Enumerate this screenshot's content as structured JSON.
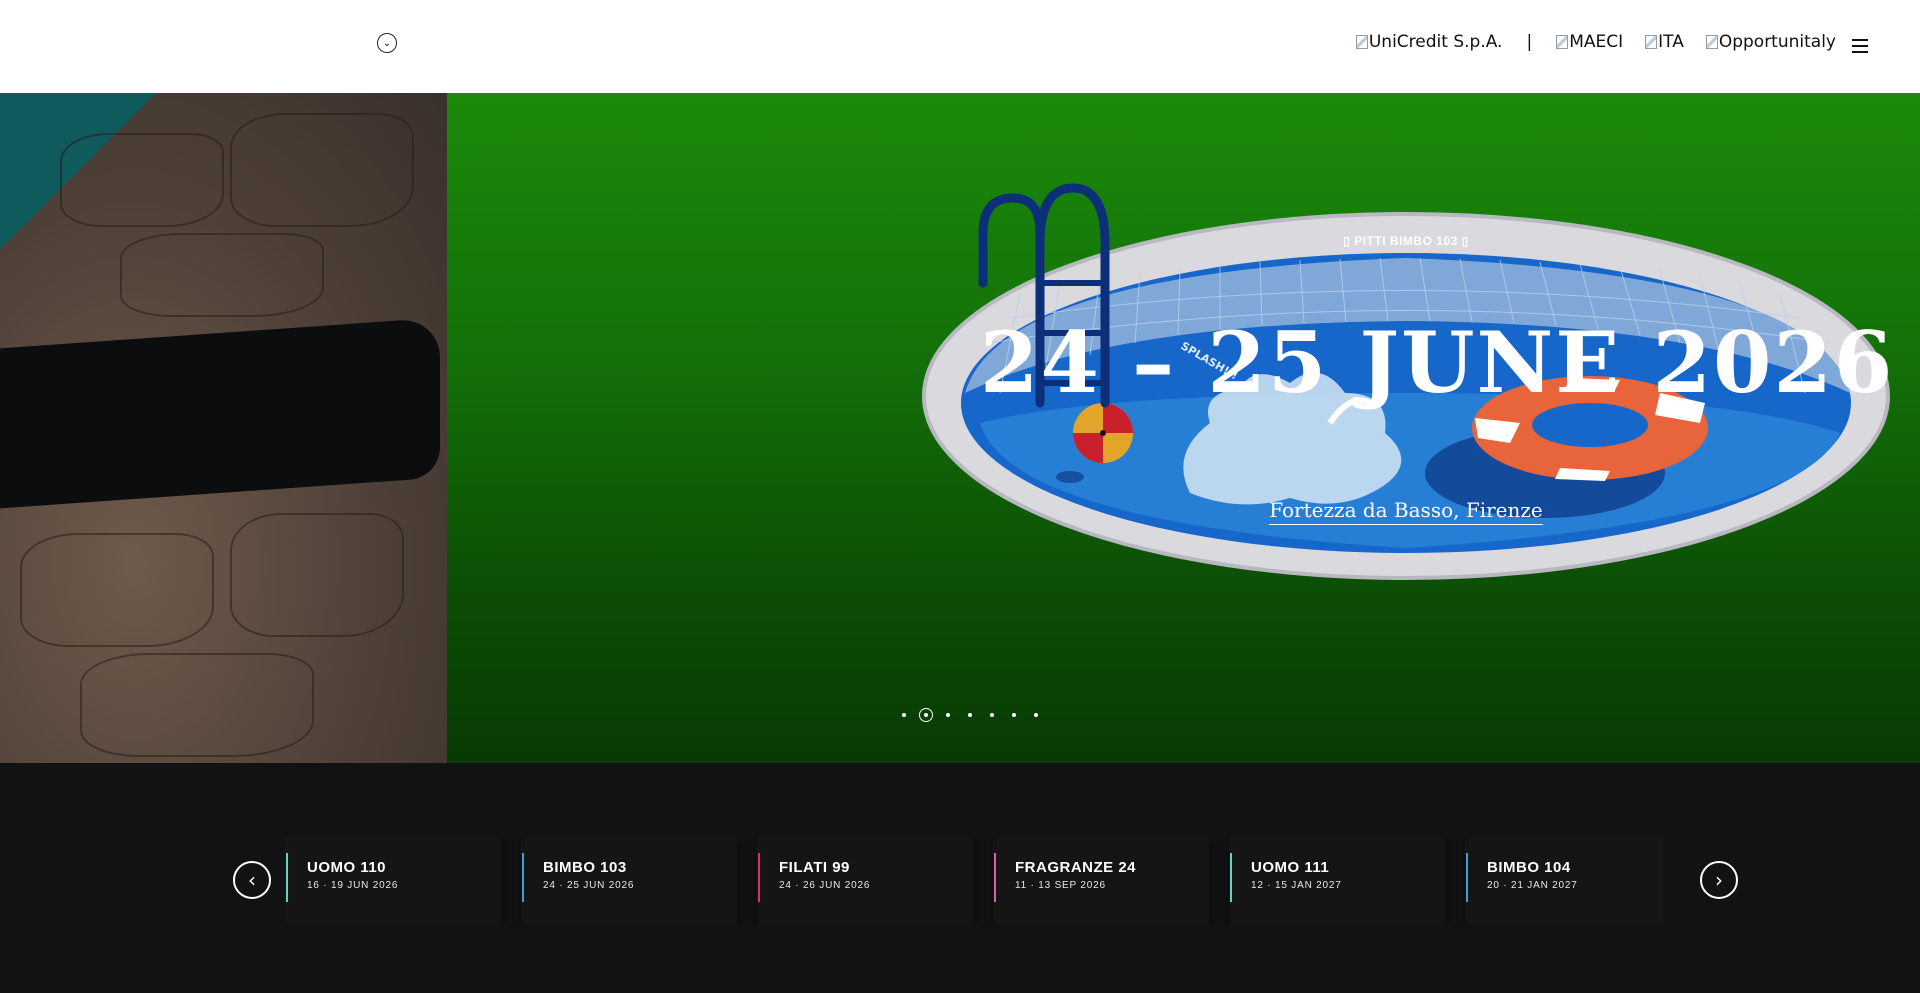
{
  "header": {
    "partners": [
      "UniCredit S.p.A.",
      "MAECI",
      "ITA",
      "Opportunitaly"
    ],
    "separator": "|"
  },
  "hero": {
    "eyebrow": "▯ PITTI BIMBO 103 ▯",
    "title": "24 – 25 JUNE 2026",
    "venue": "Fortezza da Basso, Firenze",
    "artwork_text": "SPLASH!!!",
    "slides_total": 7,
    "active_slide": 2,
    "accent_green": "#1b8a0b"
  },
  "events": [
    {
      "name": "UOMO 110",
      "dates": "16 · 19 JUN 2026",
      "color": "#5fd3c4"
    },
    {
      "name": "BIMBO 103",
      "dates": "24 · 25 JUN 2026",
      "color": "#3ba0d8"
    },
    {
      "name": "FILATI 99",
      "dates": "24 · 26 JUN 2026",
      "color": "#e0306a"
    },
    {
      "name": "FRAGRANZE 24",
      "dates": "11 · 13 SEP 2026",
      "color": "#d75fa8"
    },
    {
      "name": "UOMO 111",
      "dates": "12 · 15 JAN 2027",
      "color": "#5fd3c4"
    },
    {
      "name": "BIMBO 104",
      "dates": "20 · 21 JAN 2027",
      "color": "#3ba0d8"
    }
  ],
  "icons": {
    "menu": "chevron-down-icon",
    "hamburger": "hamburger-icon",
    "prev": "chevron-left-icon",
    "next": "chevron-right-icon"
  }
}
